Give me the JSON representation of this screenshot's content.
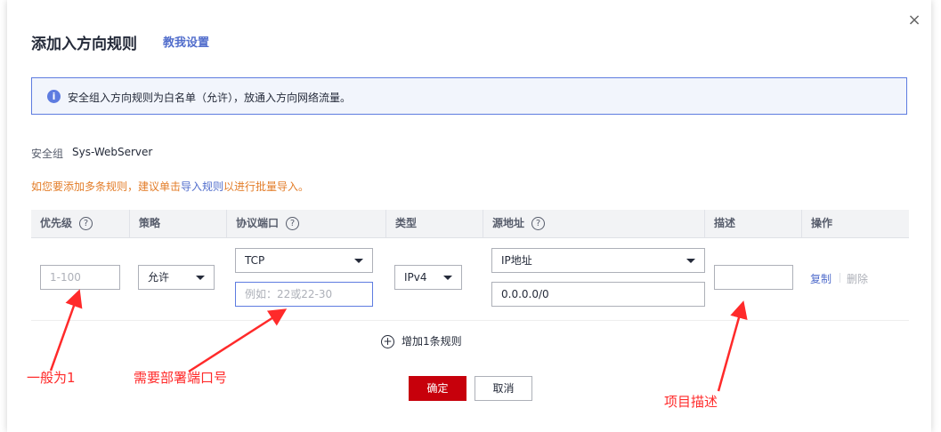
{
  "dialog": {
    "title": "添加入方向规则",
    "help_link": "教我设置",
    "close_icon": "×"
  },
  "notice": {
    "icon": "i",
    "text": "安全组入方向规则为白名单（允许），放通入方向网络流量。"
  },
  "security_group": {
    "label": "安全组",
    "value": "Sys-WebServer"
  },
  "tip": {
    "prefix": "如您要添加多条规则，建议单击",
    "link": "导入规则",
    "suffix": "以进行批量导入。"
  },
  "table": {
    "headers": {
      "priority": "优先级",
      "policy": "策略",
      "protocol_port": "协议端口",
      "type": "类型",
      "source": "源地址",
      "description": "描述",
      "actions": "操作"
    },
    "help_icon": "?",
    "row": {
      "priority_placeholder": "1-100",
      "policy": "允许",
      "protocol": "TCP",
      "port_placeholder": "例如：22或22-30",
      "type": "IPv4",
      "source_type": "IP地址",
      "source_value": "0.0.0.0/0",
      "description_value": "",
      "copy": "复制",
      "delete": "删除"
    }
  },
  "add_rule": {
    "icon": "+",
    "label": "增加1条规则"
  },
  "buttons": {
    "ok": "确定",
    "cancel": "取消"
  },
  "annotations": {
    "priority_note": "一般为1",
    "port_note": "需要部署端口号",
    "description_note": "项目描述"
  },
  "colors": {
    "brand_red": "#c7000b",
    "link_blue": "#526ecc",
    "tip_orange": "#e37d29",
    "annotation_red": "#ff2a2a"
  }
}
